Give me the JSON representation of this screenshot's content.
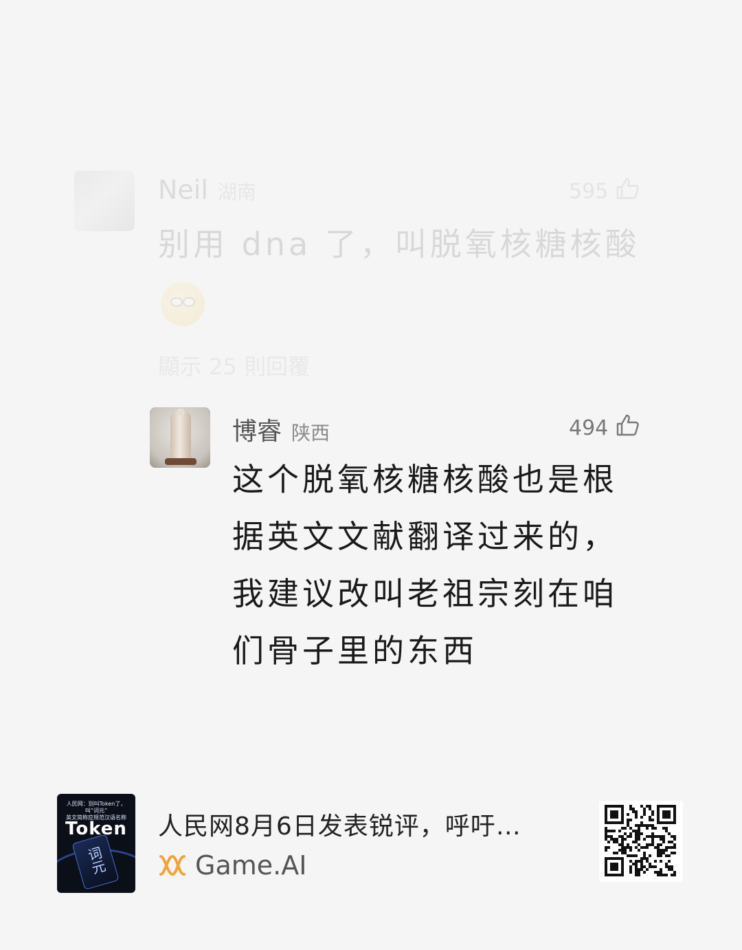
{
  "comments": [
    {
      "username": "Neil",
      "location": "湖南",
      "likes": "595",
      "text": "别用 dna 了，叫脱氧核糖核酸",
      "emoji_icon": "smug-face-emoji-icon",
      "replies_label": "顯示 25 則回覆"
    },
    {
      "username": "博睿",
      "location": "陕西",
      "likes": "494",
      "text": "这个脱氧核糖核酸也是根据英文文献翻译过来的，我建议改叫老祖宗刻在咱们骨子里的东西"
    }
  ],
  "footer": {
    "title": "人民网8月6日发表锐评，呼吁…",
    "source": "Game.AI",
    "thumbnail": {
      "top_text": "人民网：别叫Token了，叫“词元”",
      "top_text_2": "英文简称应规范汉语名称",
      "title": "Token",
      "card_text": "词元"
    }
  },
  "colors": {
    "background": "#f5f5f5",
    "text": "#1a1a1a",
    "secondary": "#8a8a8a",
    "source_logo": "#f2a33a"
  }
}
